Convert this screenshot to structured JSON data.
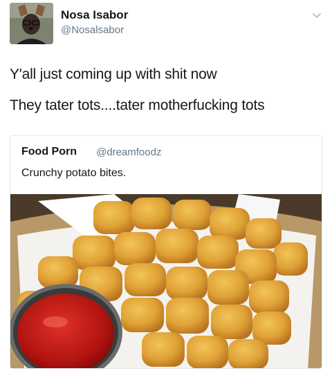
{
  "tweet": {
    "author_name": "Nosa Isabor",
    "author_handle": "@Nosalsabor",
    "text_lines": [
      "Y'all just coming up with shit now",
      "They tater tots....tater motherfucking tots"
    ]
  },
  "quoted_tweet": {
    "author_name": "Food Porn",
    "author_handle": "@dreamfoodz",
    "text": "Crunchy potato bites."
  },
  "icons": {
    "menu": "chevron-down-icon"
  },
  "colors": {
    "text_primary": "#14171a",
    "text_secondary": "#657786",
    "border": "#e1e8ed"
  }
}
